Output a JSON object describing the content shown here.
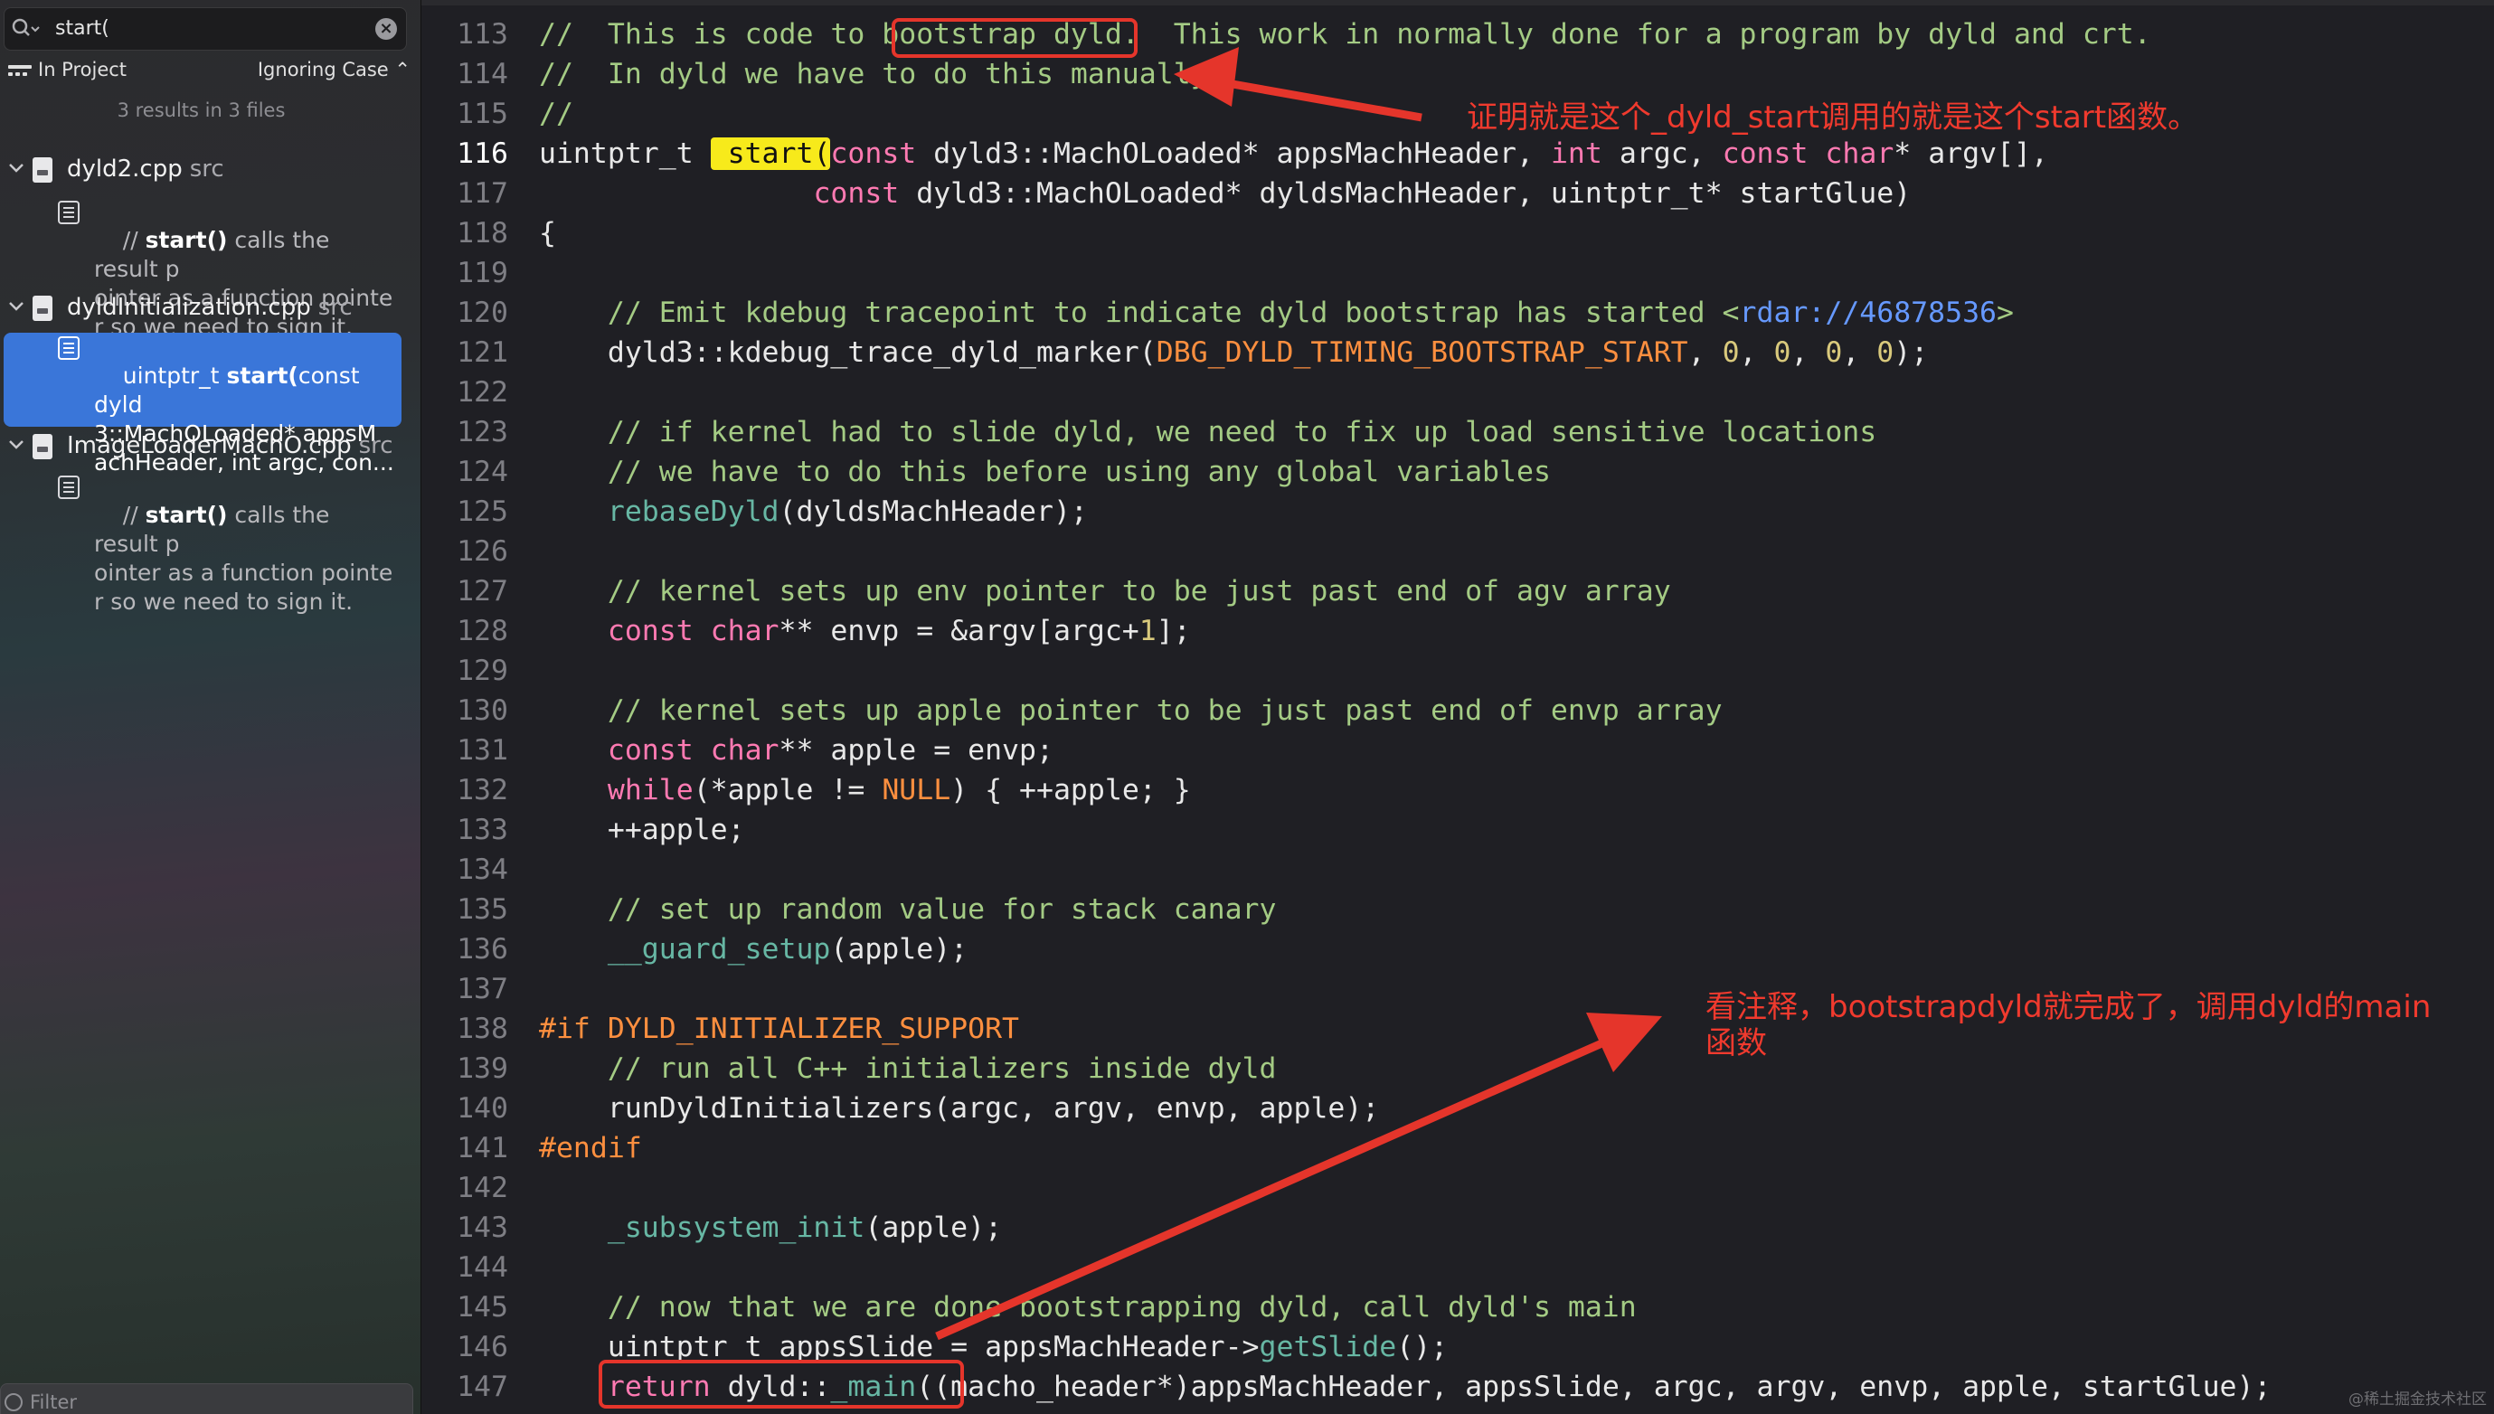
{
  "search": {
    "query": "start("
  },
  "scope": {
    "label": "In Project",
    "case_label": "Ignoring Case ⌃"
  },
  "results_count": "3 results in 3 files",
  "files": [
    {
      "name": "dyld2.cpp",
      "dir": "src",
      "match_pre": "// ",
      "match_bold": "start()",
      "match_post": " calls the result p\nointer as a function pointe\nr so we need to sign it."
    },
    {
      "name": "dyldInitialization.cpp",
      "dir": "src",
      "match_pre": "uintptr_t ",
      "match_bold": "start(",
      "match_post": "const dyld\n3::MachOLoaded* appsM\nachHeader, int argc, con..."
    },
    {
      "name": "ImageLoaderMachO.cpp",
      "dir": "src",
      "match_pre": "// ",
      "match_bold": "start()",
      "match_post": " calls the result p\nointer as a function pointe\nr so we need to sign it."
    }
  ],
  "filter_placeholder": "Filter",
  "line_numbers": [
    "113",
    "114",
    "115",
    "116",
    "117",
    "118",
    "119",
    "120",
    "121",
    "122",
    "123",
    "124",
    "125",
    "126",
    "127",
    "128",
    "129",
    "130",
    "131",
    "132",
    "133",
    "134",
    "135",
    "136",
    "137",
    "138",
    "139",
    "140",
    "141",
    "142",
    "143",
    "144",
    "145",
    "146",
    "147"
  ],
  "annotations": {
    "top": "证明就是这个_dyld_start调用的就是这个start函数。",
    "bottom_line1": "看注释，bootstrapdyld就完成了，调用dyld的main",
    "bottom_line2": "函数"
  },
  "watermark": "@稀土掘金技术社区",
  "colors": {
    "annotation_red": "#e5352b",
    "selection_blue": "#3a76d9",
    "highlight_yellow": "#f7ea1b"
  }
}
